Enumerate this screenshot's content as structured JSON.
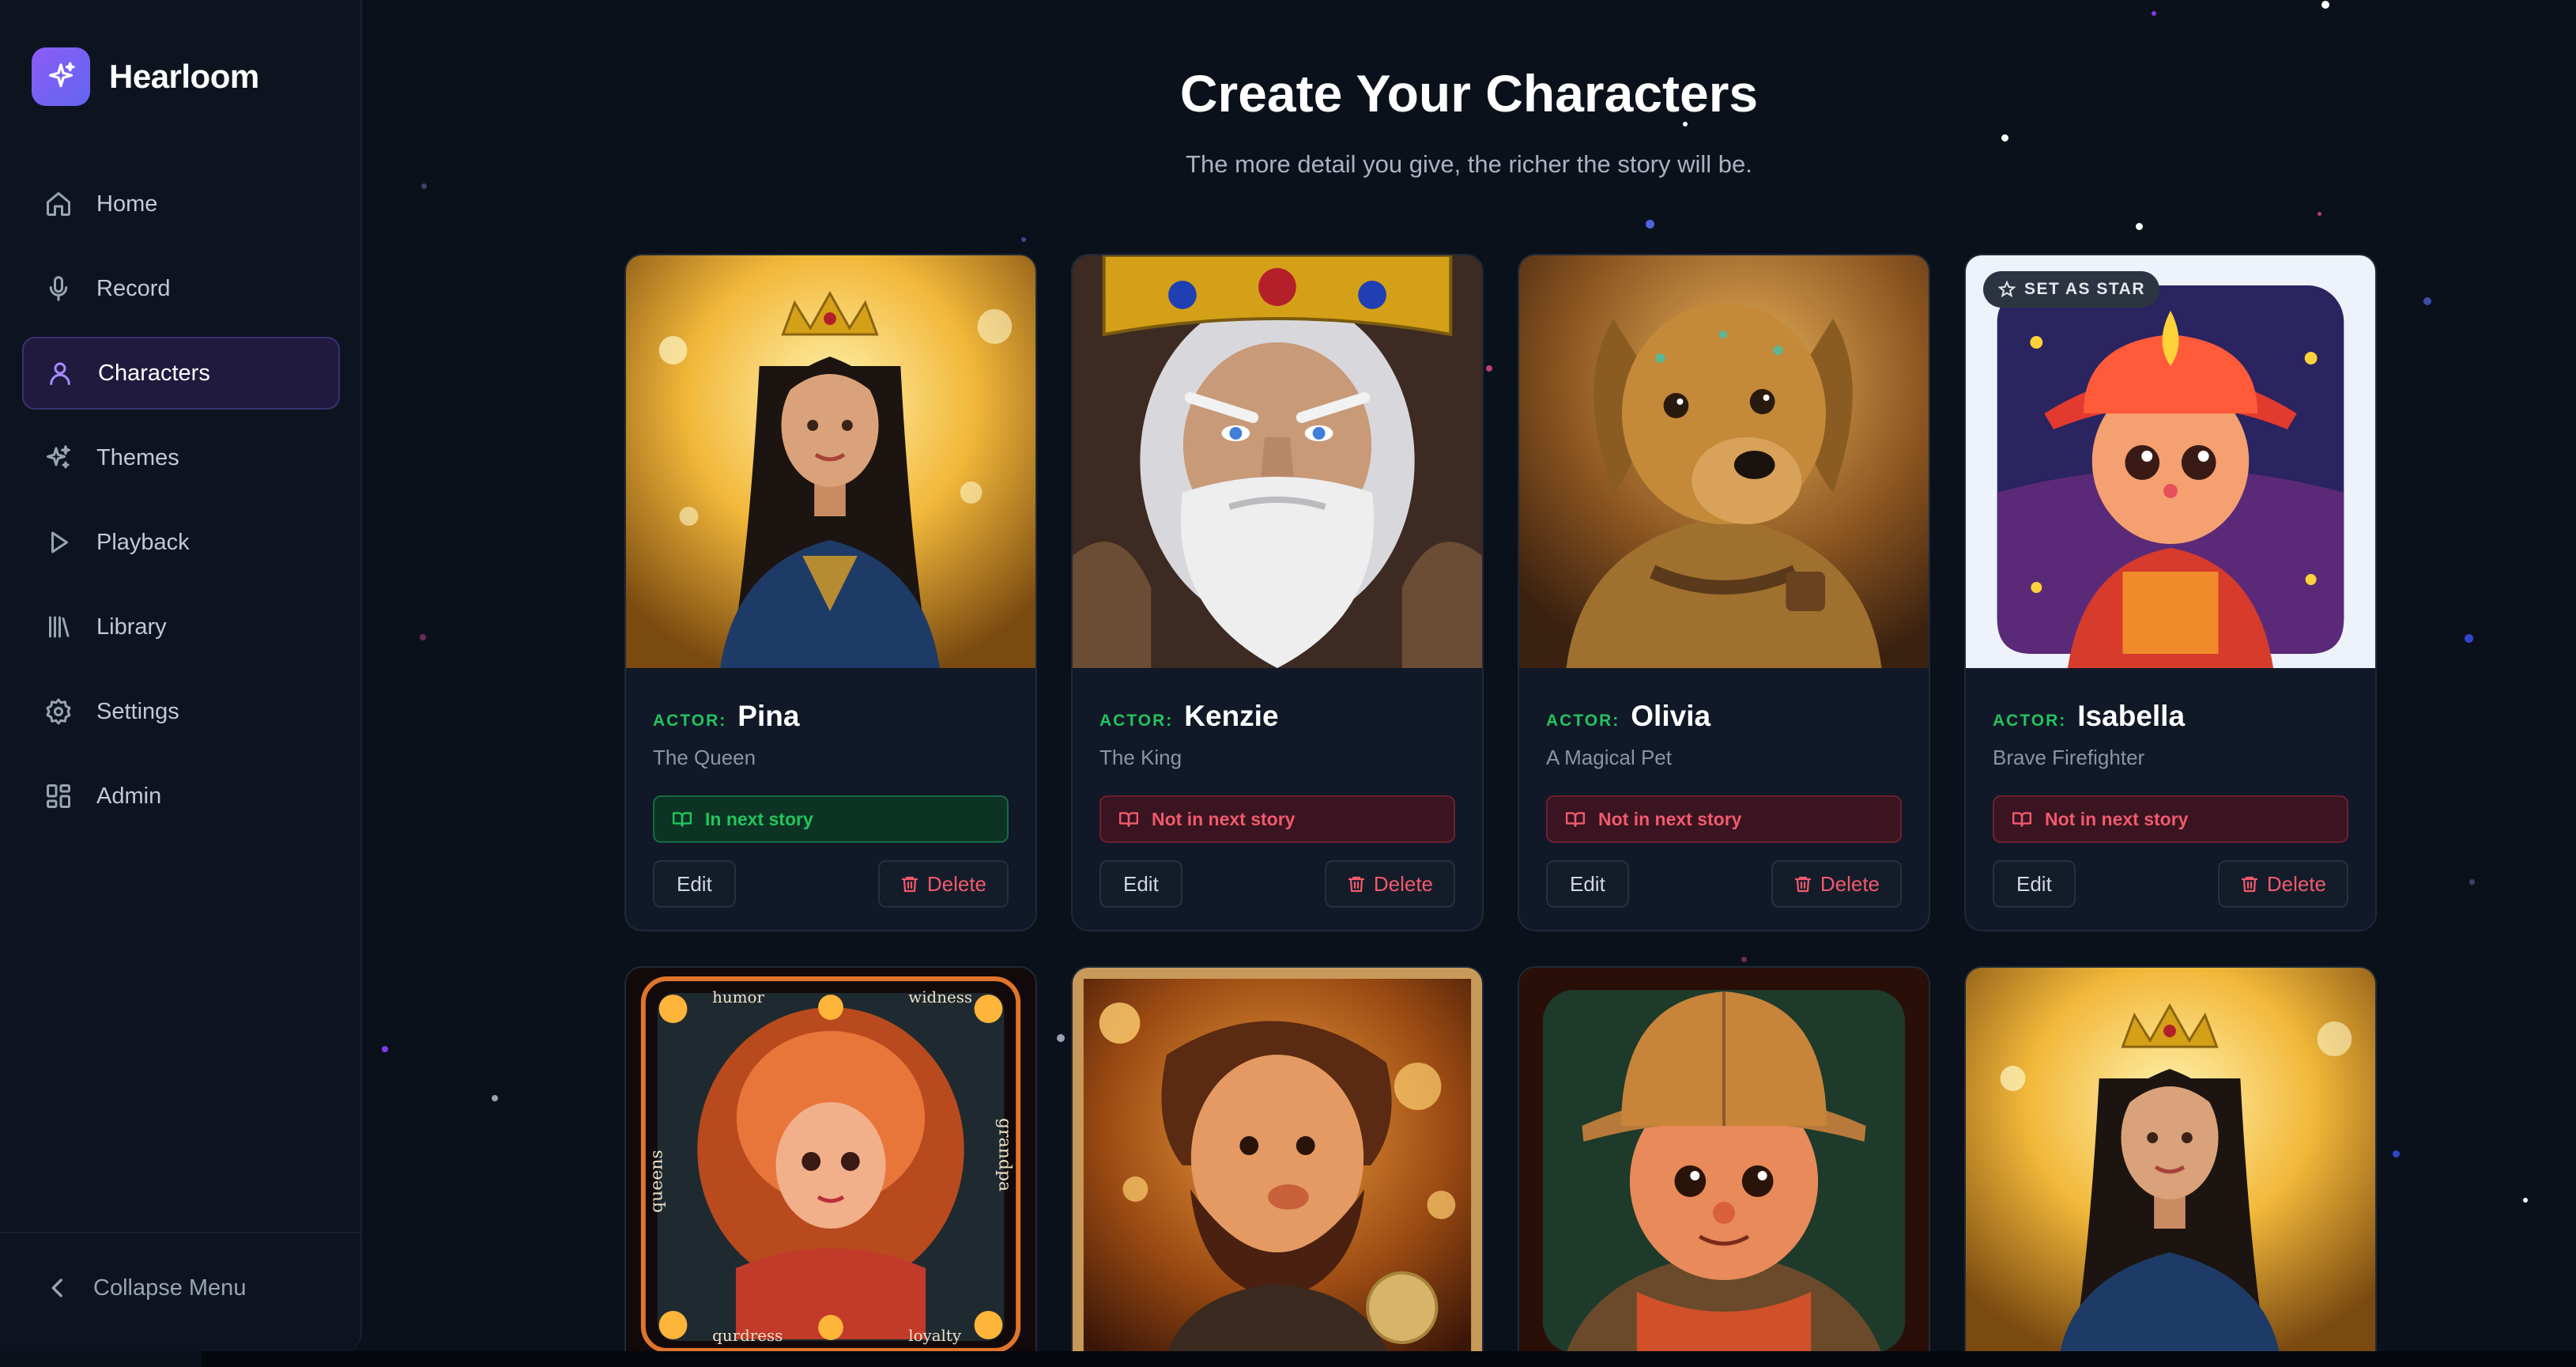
{
  "app": {
    "name": "Hearloom"
  },
  "sidebar": {
    "items": [
      {
        "label": "Home",
        "icon": "home-icon",
        "active": false
      },
      {
        "label": "Record",
        "icon": "microphone-icon",
        "active": false
      },
      {
        "label": "Characters",
        "icon": "user-icon",
        "active": true
      },
      {
        "label": "Themes",
        "icon": "sparkles-icon",
        "active": false
      },
      {
        "label": "Playback",
        "icon": "play-icon",
        "active": false
      },
      {
        "label": "Library",
        "icon": "library-icon",
        "active": false
      },
      {
        "label": "Settings",
        "icon": "gear-icon",
        "active": false
      },
      {
        "label": "Admin",
        "icon": "dashboard-icon",
        "active": false
      }
    ],
    "collapse_label": "Collapse Menu"
  },
  "header": {
    "title": "Create Your Characters",
    "subtitle": "The more detail you give, the richer the story will be."
  },
  "cards": [
    {
      "actor_tag": "ACTOR:",
      "name": "Pina",
      "role": "The Queen",
      "status": "In next story",
      "in_story": true,
      "edit_label": "Edit",
      "delete_label": "Delete",
      "portrait": "queen-portrait"
    },
    {
      "actor_tag": "ACTOR:",
      "name": "Kenzie",
      "role": "The King",
      "status": "Not in next story",
      "in_story": false,
      "edit_label": "Edit",
      "delete_label": "Delete",
      "portrait": "king-portrait"
    },
    {
      "actor_tag": "ACTOR:",
      "name": "Olivia",
      "role": "A Magical Pet",
      "status": "Not in next story",
      "in_story": false,
      "edit_label": "Edit",
      "delete_label": "Delete",
      "portrait": "dog-portrait"
    },
    {
      "actor_tag": "ACTOR:",
      "name": "Isabella",
      "role": "Brave Firefighter",
      "status": "Not in next story",
      "in_story": false,
      "edit_label": "Edit",
      "delete_label": "Delete",
      "portrait": "firefighter-portrait",
      "star_badge": "SET AS STAR"
    }
  ],
  "second_row": [
    {
      "portrait": "tarot-girl-portrait",
      "frame_text": [
        "humor",
        "widness",
        "queens",
        "grandpa",
        "qurdress",
        "loyalty"
      ]
    },
    {
      "portrait": "bearded-man-portrait"
    },
    {
      "portrait": "explorer-boy-portrait"
    },
    {
      "portrait": "queen-portrait-repeat"
    }
  ],
  "colors": {
    "accent": "#8b5cf6",
    "in_story": "#22c55e",
    "not_in_story": "#f05a6e",
    "background": "#0b111b"
  }
}
